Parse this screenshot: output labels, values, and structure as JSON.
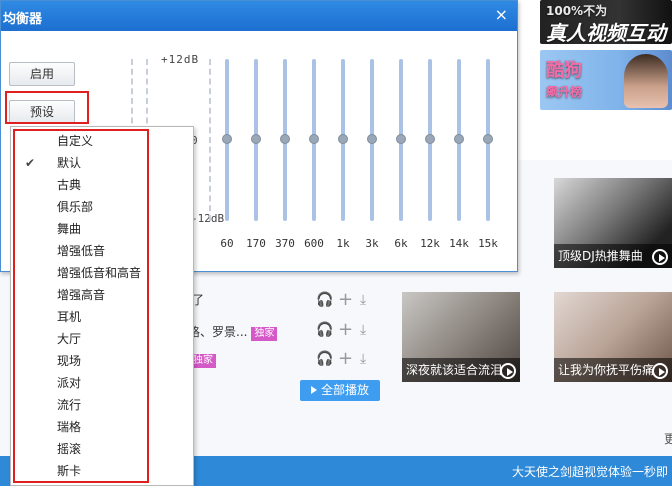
{
  "ads": {
    "ad1_line1": "100%不为",
    "ad1_line2": "真人视频互动",
    "ad2_line1": "酷狗",
    "ad2_line2": "飙升榜"
  },
  "tiles": [
    {
      "caption": "顶级DJ热推舞曲"
    },
    {
      "caption": "深夜就该适合流泪"
    },
    {
      "caption": "让我为你抚平伤痛"
    }
  ],
  "songs": [
    {
      "text": "了"
    },
    {
      "text": "嘉格、罗景...",
      "tag": "独家"
    },
    {
      "text": "",
      "tag": "独家"
    }
  ],
  "play_all_label": "全部播放",
  "more_label": "更",
  "footer_text": "大天使之剑超视觉体验一秒即",
  "equalizer": {
    "title": "均衡器",
    "close_icon": "×",
    "enable_label": "启用",
    "preset_label": "预设",
    "db_top": "+12dB",
    "db_mid": "0",
    "db_low": "-12dB",
    "bands": [
      "60",
      "170",
      "370",
      "600",
      "1k",
      "3k",
      "6k",
      "12k",
      "14k",
      "15k"
    ],
    "band_levels_db": [
      0,
      0,
      0,
      0,
      0,
      0,
      0,
      0,
      0,
      0
    ]
  },
  "preset_menu": {
    "selected": "默认",
    "items": [
      "自定义",
      "默认",
      "古典",
      "俱乐部",
      "舞曲",
      "增强低音",
      "增强低音和高音",
      "增强高音",
      "耳机",
      "大厅",
      "现场",
      "派对",
      "流行",
      "瑞格",
      "摇滚",
      "斯卡"
    ]
  },
  "colors": {
    "titlebar": "#1d6fd0",
    "highlight_outline": "#e01f1f",
    "footer": "#2e8ad8"
  }
}
